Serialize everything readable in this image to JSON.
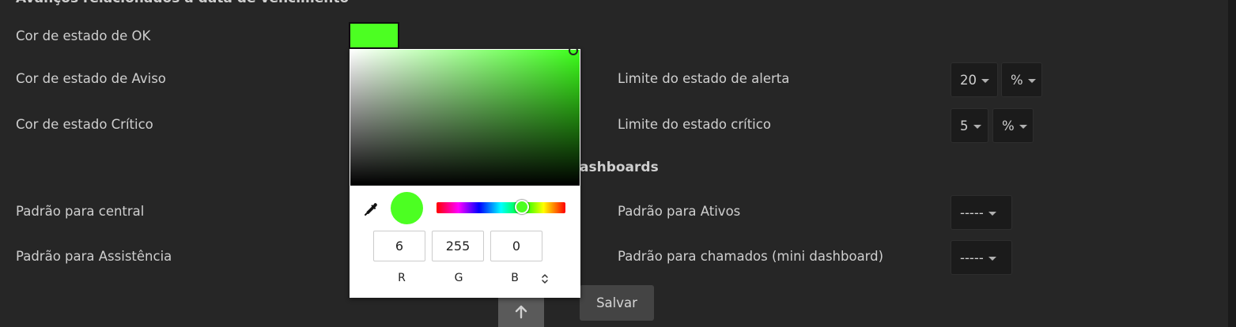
{
  "sections": {
    "due_date_title": "Avanços relacionados a data de vencimento",
    "dashboards_title": "ashboards"
  },
  "left_fields": {
    "ok_color_label": "Cor de estado de OK",
    "warning_color_label": "Cor de estado de Aviso",
    "critical_color_label": "Cor de estado Crítico",
    "central_default_label": "Padrão para central",
    "assistance_default_label": "Padrão para Assistência"
  },
  "right_fields": {
    "alert_limit_label": "Limite do estado de alerta",
    "alert_limit_value": "20",
    "alert_limit_unit": "%",
    "critical_limit_label": "Limite do estado crítico",
    "critical_limit_value": "5",
    "critical_limit_unit": "%",
    "assets_default_label": "Padrão para Ativos",
    "assets_default_value": "-----",
    "tickets_default_label": "Padrão para chamados (mini dashboard)",
    "tickets_default_value": "-----"
  },
  "color_picker": {
    "r_value": "6",
    "g_value": "255",
    "b_value": "0",
    "r_label": "R",
    "g_label": "G",
    "b_label": "B",
    "current_color": "#4cff22"
  },
  "buttons": {
    "save_label": "Salvar"
  },
  "icons": {
    "eyedropper": "eyedropper-icon",
    "mode_toggle": "chevron-up-down-icon",
    "scroll_top": "arrow-up-icon"
  }
}
